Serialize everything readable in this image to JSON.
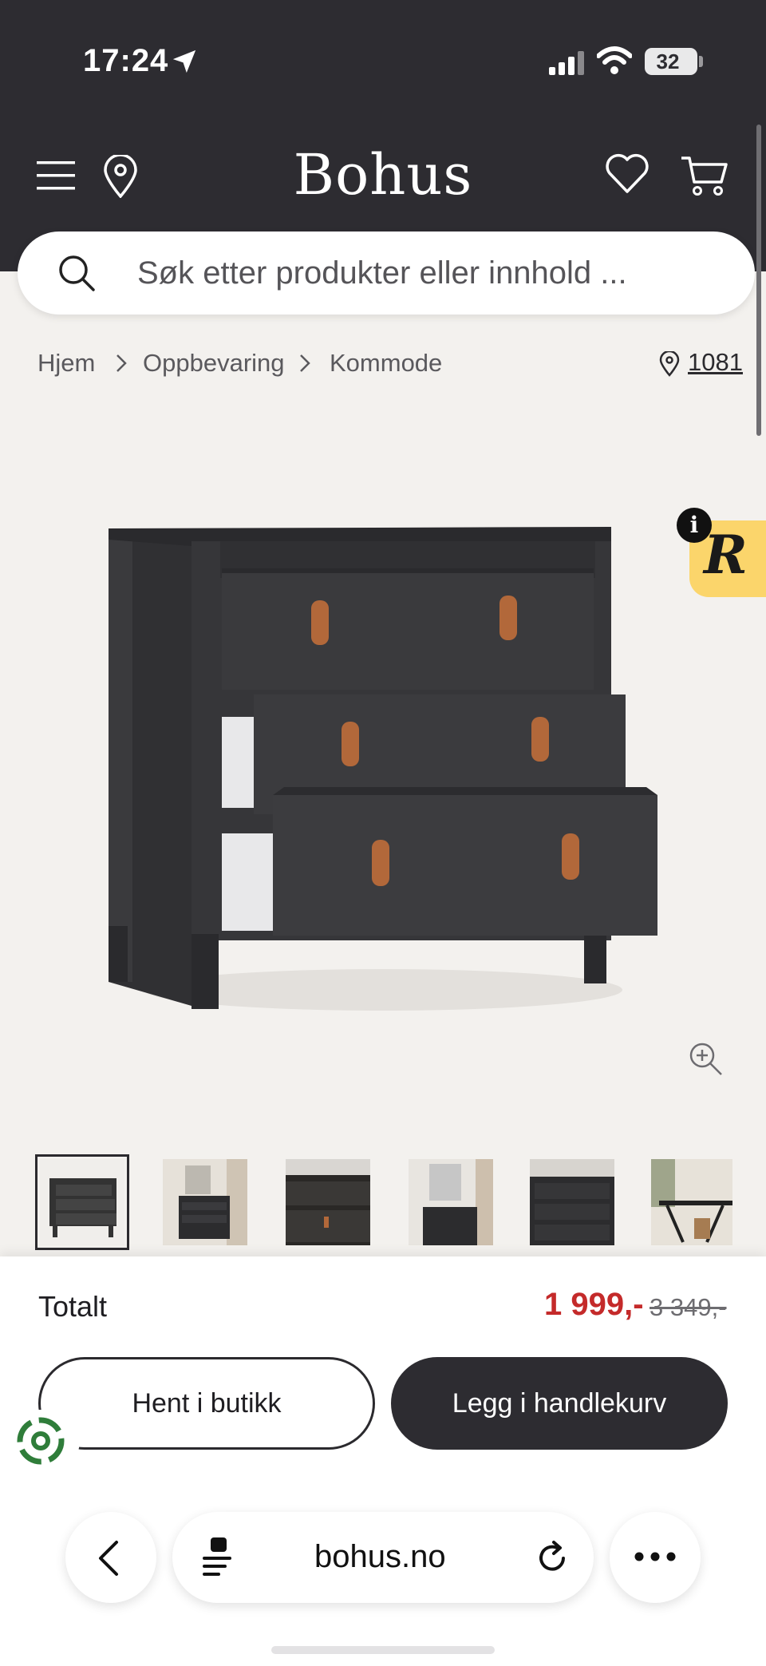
{
  "status_bar": {
    "time": "17:24",
    "battery": "32"
  },
  "header": {
    "brand": "Bohus",
    "search_placeholder": "Søk etter produkter eller innhold ..."
  },
  "breadcrumb": {
    "items": [
      "Hjem",
      "Oppbevaring",
      "Kommode"
    ],
    "store_id": "1081"
  },
  "badge": {
    "letter": "R",
    "info": "i"
  },
  "thumbnails": {
    "count": 6,
    "selected_index": 0
  },
  "purchase": {
    "total_label": "Totalt",
    "price_current": "1 999,-",
    "price_original": "3 349,-",
    "pickup_button": "Hent i butikk",
    "add_to_cart_button": "Legg i handlekurv"
  },
  "browser": {
    "url": "bohus.no"
  },
  "colors": {
    "header_bg": "#2d2c31",
    "price_red": "#c42a2a",
    "badge_yellow": "#fbd56b",
    "page_bg": "#f3f1ee"
  }
}
